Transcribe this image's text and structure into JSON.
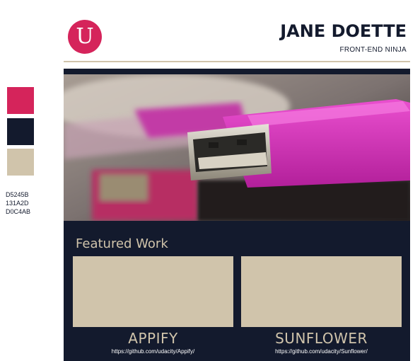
{
  "palette": {
    "colors": [
      "#D5245B",
      "#131A2D",
      "#D0C4AB"
    ],
    "labels": [
      "D5245B",
      "131A2D",
      "D0C4AB"
    ]
  },
  "header": {
    "logo_letter": "U",
    "name": "JANE DOETTE",
    "role": "FRONT-END NINJA"
  },
  "hero": {
    "icon": "usb-drive-photo"
  },
  "featured": {
    "heading": "Featured Work",
    "projects": [
      {
        "title": "APPIFY",
        "url": "https://github.com/udacity/Appify/"
      },
      {
        "title": "SUNFLOWER",
        "url": "https://github.com/udacity/Sunflower/"
      }
    ]
  }
}
